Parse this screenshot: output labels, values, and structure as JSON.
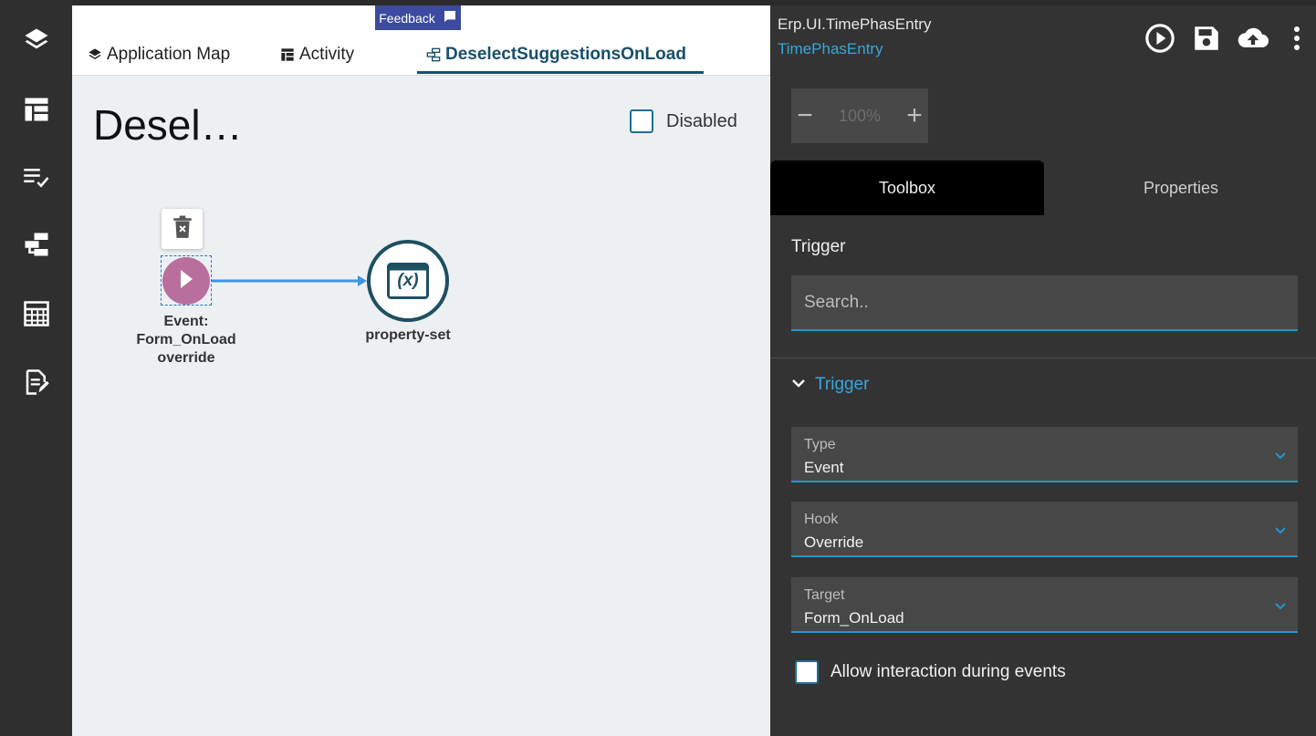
{
  "rail": {
    "items": [
      {
        "icon": "layers-icon"
      },
      {
        "icon": "table-layout-icon"
      },
      {
        "icon": "checklist-icon"
      },
      {
        "icon": "flow-icon"
      },
      {
        "icon": "grid-icon"
      },
      {
        "icon": "edit-document-icon"
      }
    ]
  },
  "tabs": {
    "application_map": "Application Map",
    "activity": "Activity",
    "deselect": "DeselectSuggestionsOnLoad"
  },
  "feedback": {
    "label": "Feedback"
  },
  "canvas": {
    "title": "Desel…",
    "disabled_label": "Disabled",
    "event_label_line1": "Event:",
    "event_label_line2": "Form_OnLoad",
    "event_label_line3": "override",
    "property_label": "property-set",
    "property_symbol": "(x)"
  },
  "right": {
    "title": "Erp.UI.TimePhasEntry",
    "subtitle": "TimePhasEntry",
    "zoom": {
      "minus": "−",
      "value": "100%",
      "plus": "+"
    },
    "tabs": {
      "toolbox": "Toolbox",
      "properties": "Properties"
    },
    "section_label": "Trigger",
    "search_placeholder": "Search..",
    "accordion_label": "Trigger",
    "fields": {
      "type": {
        "label": "Type",
        "value": "Event"
      },
      "hook": {
        "label": "Hook",
        "value": "Override"
      },
      "target": {
        "label": "Target",
        "value": "Form_OnLoad"
      }
    },
    "allow_label": "Allow interaction during events"
  },
  "colors": {
    "accent": "#35a8dc",
    "active_tab": "#184f6b",
    "event_node": "#b96f9e",
    "feedback": "#3c4ba0"
  }
}
